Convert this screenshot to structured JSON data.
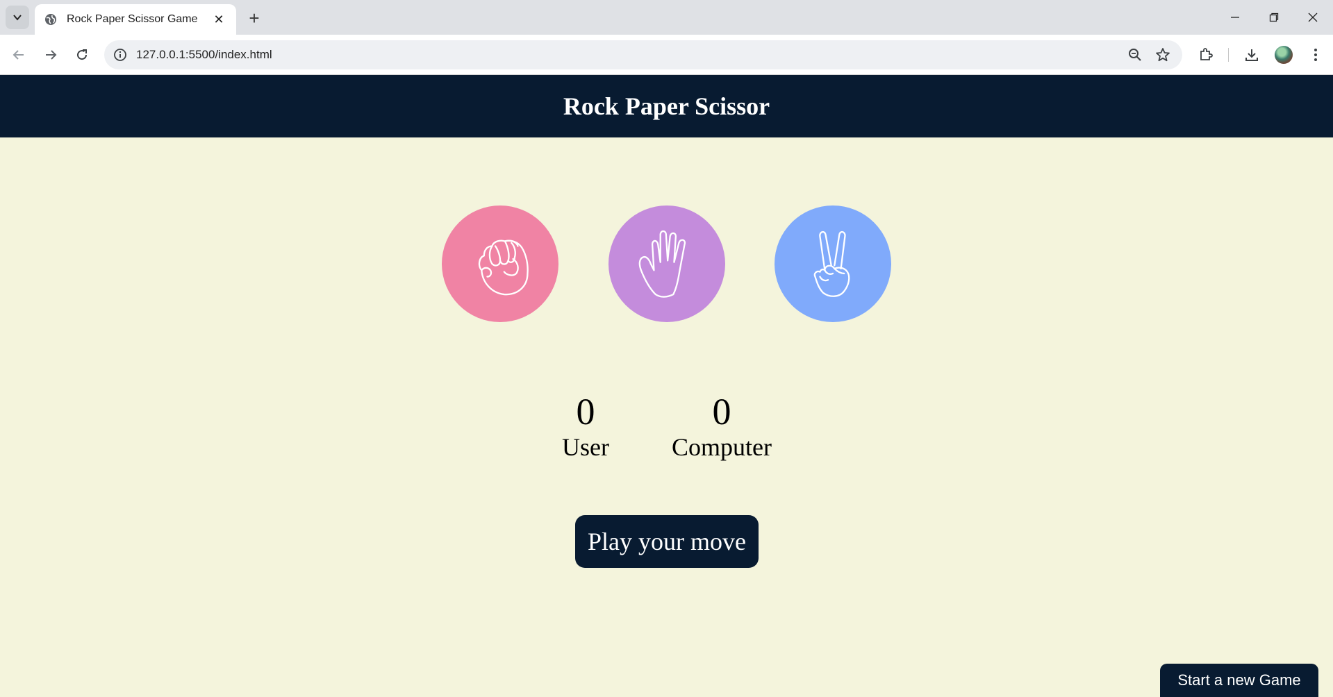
{
  "browser": {
    "tab_title": "Rock Paper Scissor Game",
    "url": "127.0.0.1:5500/index.html"
  },
  "game": {
    "heading": "Rock Paper Scissor",
    "choices": [
      {
        "name": "rock",
        "color": "#f083a4"
      },
      {
        "name": "paper",
        "color": "#c48cdc"
      },
      {
        "name": "scissors",
        "color": "#80aafb"
      }
    ],
    "user_score": "0",
    "user_label": "User",
    "computer_score": "0",
    "computer_label": "Computer",
    "message": "Play your move",
    "reset_label": "Start a new Game"
  }
}
